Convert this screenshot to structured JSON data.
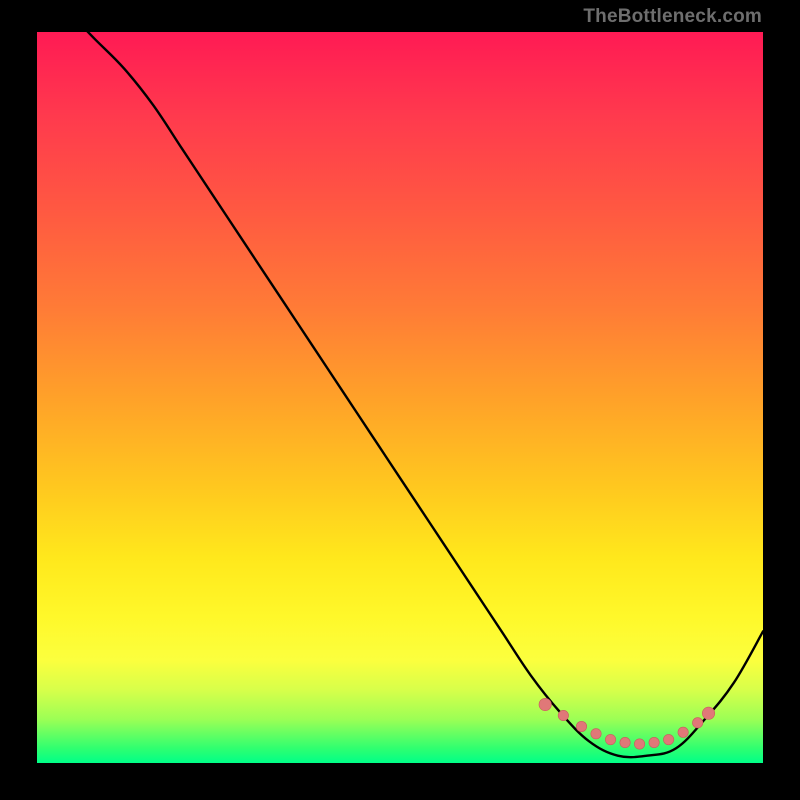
{
  "watermark": "TheBottleneck.com",
  "colors": {
    "background": "#000000",
    "curve": "#000000",
    "marker_fill": "#e07878",
    "marker_stroke": "#c95d5d"
  },
  "chart_data": {
    "type": "line",
    "title": "",
    "xlabel": "",
    "ylabel": "",
    "xlim": [
      0,
      100
    ],
    "ylim": [
      0,
      100
    ],
    "series": [
      {
        "name": "curve",
        "x": [
          0,
          4,
          8,
          12,
          16,
          20,
          24,
          28,
          32,
          36,
          40,
          44,
          48,
          52,
          56,
          60,
          64,
          68,
          72,
          76,
          80,
          84,
          88,
          92,
          96,
          100
        ],
        "y": [
          106,
          103,
          99,
          95,
          90,
          84,
          78,
          72,
          66,
          60,
          54,
          48,
          42,
          36,
          30,
          24,
          18,
          12,
          7,
          3,
          1,
          1,
          2,
          6,
          11,
          18
        ]
      }
    ],
    "annotations": {
      "markers_bottom": {
        "x": [
          70,
          72.5,
          75,
          77,
          79,
          81,
          83,
          85,
          87,
          89,
          91,
          92.5
        ],
        "y": [
          8,
          6.5,
          5,
          4,
          3.2,
          2.8,
          2.6,
          2.8,
          3.2,
          4.2,
          5.5,
          6.8
        ]
      }
    }
  }
}
